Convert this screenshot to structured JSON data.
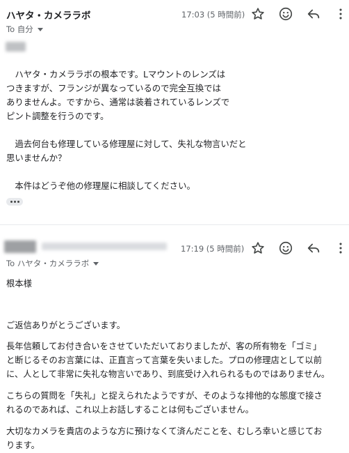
{
  "messages": [
    {
      "sender": "ハヤタ・カメララボ",
      "time": "17:03 (5 時間前)",
      "to_label": "To 自分",
      "body": {
        "para1": [
          "　ハヤタ・カメララボの根本です。Lマウントのレンズは",
          "つきますが、フランジが異なっているので完全互換では",
          "ありませんよ。ですから、通常は装着されているレンズで",
          "ピント調整を行うのです。"
        ],
        "para2": [
          "　過去何台も修理している修理屋に対して、失礼な物言いだと",
          "思いませんか？"
        ],
        "para3": [
          "　本件はどうぞ他の修理屋に相談してください。"
        ]
      }
    },
    {
      "time": "17:19 (5 時間前)",
      "to_label": "To ハヤタ・カメララボ",
      "body": {
        "salutation": "根本様",
        "p1": "ご返信ありがとうございます。",
        "p2": [
          "長年信頼してお付き合いをさせていただいておりましたが、客の所有物を「ゴミ」",
          "と断じるそのお言葉には、正直言って言葉を失いました。プロの修理店として以前",
          "に、人として非常に失礼な物言いであり、到底受け入れられるものではありません。"
        ],
        "p3": [
          "こちらの質問を「失礼」と捉えられたようですが、そのような排他的な態度で接さ",
          "れるのであれば、これ以上お話しすることは何もございません。"
        ],
        "p4": [
          "大切なカメラを貴店のような方に預けなくて済んだことを、むしろ幸いと感じてお",
          "ります。"
        ]
      }
    }
  ],
  "icons": [
    "star-icon",
    "emoji-icon",
    "reply-icon",
    "more-vert-icon"
  ],
  "colors": {
    "text": "#202124",
    "secondary": "#5f6368",
    "icon": "#444746",
    "divider": "#e8eaed"
  }
}
